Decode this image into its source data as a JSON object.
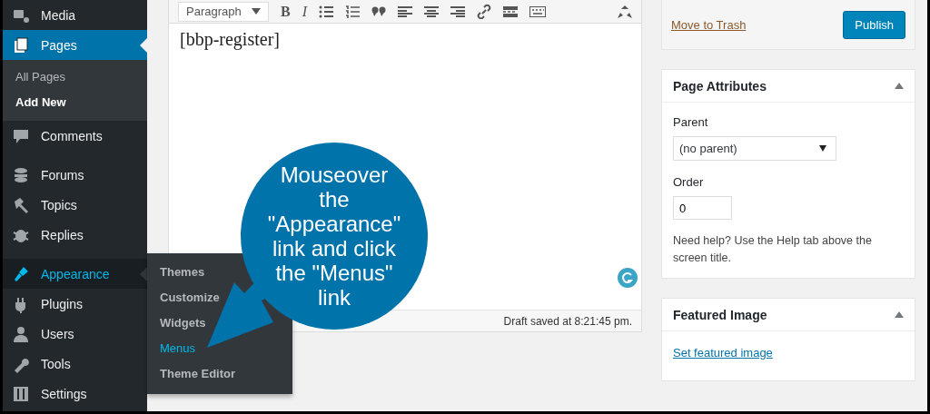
{
  "sidebar": {
    "items": [
      {
        "kind": "menu",
        "label": "Media",
        "selected": false,
        "hovered": false
      },
      {
        "kind": "menu",
        "label": "Pages",
        "selected": true,
        "hovered": false,
        "submenu": [
          {
            "label": "All Pages",
            "selected": false
          },
          {
            "label": "Add New",
            "selected": true
          }
        ]
      },
      {
        "kind": "menu",
        "label": "Comments",
        "selected": false,
        "hovered": false
      },
      {
        "kind": "separator"
      },
      {
        "kind": "menu",
        "label": "Forums",
        "selected": false,
        "hovered": false
      },
      {
        "kind": "menu",
        "label": "Topics",
        "selected": false,
        "hovered": false
      },
      {
        "kind": "menu",
        "label": "Replies",
        "selected": false,
        "hovered": false
      },
      {
        "kind": "separator"
      },
      {
        "kind": "menu",
        "label": "Appearance",
        "selected": false,
        "hovered": true,
        "flyout": [
          {
            "label": "Themes",
            "highlighted": false
          },
          {
            "label": "Customize",
            "highlighted": false
          },
          {
            "label": "Widgets",
            "highlighted": false
          },
          {
            "label": "Menus",
            "highlighted": true
          },
          {
            "label": "Theme Editor",
            "highlighted": false
          }
        ]
      },
      {
        "kind": "menu",
        "label": "Plugins",
        "selected": false,
        "hovered": false
      },
      {
        "kind": "menu",
        "label": "Users",
        "selected": false,
        "hovered": false
      },
      {
        "kind": "menu",
        "label": "Tools",
        "selected": false,
        "hovered": false
      },
      {
        "kind": "menu",
        "label": "Settings",
        "selected": false,
        "hovered": false
      }
    ]
  },
  "editor": {
    "format_select": "Paragraph",
    "toolbar_text_buttons": [
      "B",
      "I"
    ],
    "content": "[bbp-register]",
    "status": "Draft saved at 8:21:45 pm."
  },
  "callout": {
    "text": "Mouseover the \"Appearance\" link and click the \"Menus\" link"
  },
  "publish_box": {
    "trash_link": "Move to Trash",
    "publish_button": "Publish"
  },
  "page_attributes": {
    "title": "Page Attributes",
    "parent_label": "Parent",
    "parent_value": "(no parent)",
    "order_label": "Order",
    "order_value": "0",
    "help": "Need help? Use the Help tab above the screen title."
  },
  "featured_image": {
    "title": "Featured Image",
    "link": "Set featured image"
  }
}
